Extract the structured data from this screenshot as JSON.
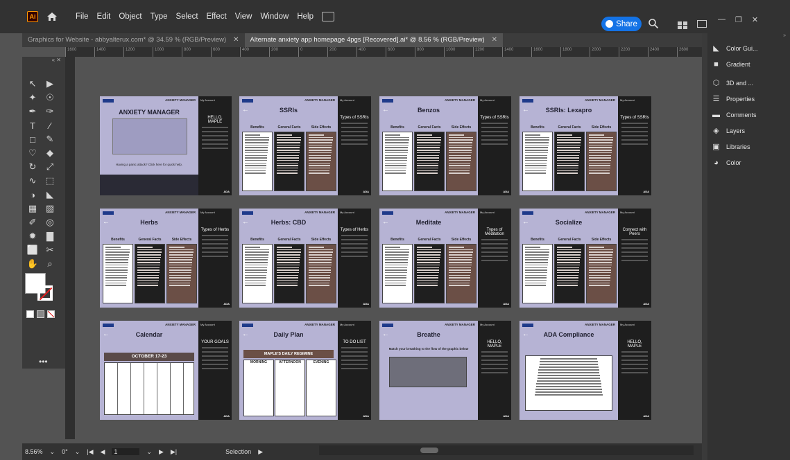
{
  "app": {
    "logo_text": "Ai",
    "menu": [
      "File",
      "Edit",
      "Object",
      "Type",
      "Select",
      "Effect",
      "View",
      "Window",
      "Help"
    ],
    "share_label": "Share"
  },
  "tabs": [
    {
      "label": "Graphics for Website - abbyalterux.com* @ 34.59 % (RGB/Preview)",
      "active": false
    },
    {
      "label": "Alternate anxiety app homepage 4pgs [Recovered].ai* @ 8.56 % (RGB/Preview)",
      "active": true
    }
  ],
  "ruler_ticks": [
    "1600",
    "1400",
    "1200",
    "1000",
    "800",
    "600",
    "400",
    "200",
    "0",
    "200",
    "400",
    "600",
    "800",
    "1000",
    "1200",
    "1400",
    "1600",
    "1800",
    "2000",
    "2200",
    "2400",
    "2600",
    "2800"
  ],
  "panels": [
    {
      "label": "Color Gui...",
      "icon": "color-guide-icon"
    },
    {
      "label": "Gradient",
      "icon": "gradient-icon"
    },
    {
      "label": "3D and ...",
      "icon": "3d-cube-icon"
    },
    {
      "label": "Properties",
      "icon": "properties-icon"
    },
    {
      "label": "Comments",
      "icon": "comments-icon"
    },
    {
      "label": "Layers",
      "icon": "layers-icon"
    },
    {
      "label": "Libraries",
      "icon": "libraries-icon"
    },
    {
      "label": "Color",
      "icon": "color-palette-icon"
    }
  ],
  "status": {
    "zoom": "8.56%",
    "rotation": "0°",
    "artboard_num": "1",
    "tool": "Selection"
  },
  "artboards": [
    {
      "title": "ANXIETY MANAGER",
      "side": "HELLO, MAPLE",
      "kind": "home",
      "footer": "Having a panic attack? Click here for quick help."
    },
    {
      "title": "SSRIs",
      "side": "Types of SSRIs",
      "kind": "info",
      "cols": [
        "Benefits",
        "General Facts",
        "Side Effects"
      ]
    },
    {
      "title": "Benzos",
      "side": "Types of SSRIs",
      "kind": "info",
      "cols": [
        "Benefits",
        "General Facts",
        "Side Effects"
      ]
    },
    {
      "title": "SSRIs: Lexapro",
      "side": "Types of SSRIs",
      "kind": "info",
      "cols": [
        "Benefits",
        "General Facts",
        "Side Effects"
      ]
    },
    {
      "title": "Herbs",
      "side": "Types of Herbs",
      "kind": "info",
      "cols": [
        "Benefits",
        "General Facts",
        "Side Effects"
      ]
    },
    {
      "title": "Herbs: CBD",
      "side": "Types of Herbs",
      "kind": "info",
      "cols": [
        "Benefits",
        "General Facts",
        "Side Effects"
      ]
    },
    {
      "title": "Meditate",
      "side": "Types of Meditation",
      "kind": "info",
      "cols": [
        "Benefits",
        "General Facts",
        "Side Effects"
      ]
    },
    {
      "title": "Socialize",
      "side": "Connect with Peers",
      "kind": "info",
      "cols": [
        "Benefits",
        "General Facts",
        "Side Effects"
      ]
    },
    {
      "title": "Calendar",
      "side": "YOUR GOALS",
      "kind": "calendar",
      "banner": "OCTOBER 17-23"
    },
    {
      "title": "Daily Plan",
      "side": "TO DO LIST",
      "kind": "plan",
      "banner": "MAPLE'S DAILY REGIMINE",
      "cols": [
        "MORNING",
        "AFTERNOON",
        "EVENING"
      ]
    },
    {
      "title": "Breathe",
      "side": "HELLO, MAPLE",
      "kind": "breathe",
      "subtitle": "Match your breathing to the flow of the graphic below"
    },
    {
      "title": "ADA Compliance",
      "side": "HELLO, MAPLE",
      "kind": "ada"
    }
  ],
  "artboard_common": {
    "brand": "ANXIETY MANAGER",
    "account": "My Account",
    "ada": "ADA"
  }
}
